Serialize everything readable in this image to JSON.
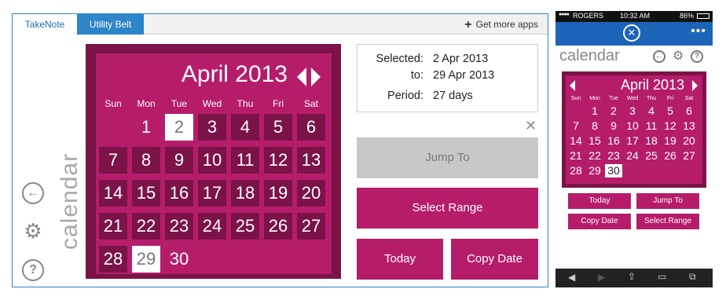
{
  "desktop": {
    "tabs": [
      "TakeNote",
      "Utility Belt"
    ],
    "get_more_apps": "Get more apps",
    "side_label": "calendar",
    "calendar": {
      "month_title": "April 2013",
      "weekdays": [
        "Sun",
        "Mon",
        "Tue",
        "Wed",
        "Thu",
        "Fri",
        "Sat"
      ],
      "days": [
        "1",
        "2",
        "3",
        "4",
        "5",
        "6",
        "7",
        "8",
        "9",
        "10",
        "11",
        "12",
        "13",
        "14",
        "15",
        "16",
        "17",
        "18",
        "19",
        "20",
        "21",
        "22",
        "23",
        "24",
        "25",
        "26",
        "27",
        "28",
        "29",
        "30"
      ]
    },
    "info": {
      "selected_label": "Selected:",
      "selected_value": "2 Apr 2013",
      "to_label": "to:",
      "to_value": "29 Apr 2013",
      "period_label": "Period:",
      "period_value": "27 days"
    },
    "buttons": {
      "jump_to": "Jump To",
      "select_range": "Select Range",
      "today": "Today",
      "copy_date": "Copy Date"
    }
  },
  "phone": {
    "status": {
      "carrier": "ROGERS",
      "time": "10:32 AM",
      "battery": "86%"
    },
    "title": "calendar",
    "calendar": {
      "month_title": "April 2013",
      "weekdays": [
        "Sun",
        "Mon",
        "Tue",
        "Wed",
        "Thu",
        "Fri",
        "Sat"
      ]
    },
    "buttons": {
      "today": "Today",
      "jump_to": "Jump To",
      "copy_date": "Copy Date",
      "select_range": "Select Range"
    }
  },
  "colors": {
    "accent": "#b51d6a",
    "dark_accent": "#7b1248",
    "tab_blue": "#2e86c9"
  }
}
